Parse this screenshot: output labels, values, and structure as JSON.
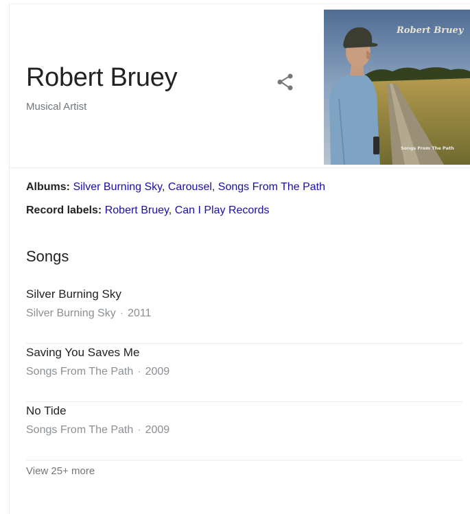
{
  "entity": {
    "name": "Robert Bruey",
    "type": "Musical Artist"
  },
  "cover": {
    "overlay_title": "Robert Bruey",
    "overlay_album": "Songs From The Path"
  },
  "facts": {
    "albums": {
      "label": "Albums:",
      "values": [
        "Silver Burning Sky",
        "Carousel",
        "Songs From The Path"
      ]
    },
    "record_labels": {
      "label": "Record labels:",
      "values": [
        "Robert Bruey",
        "Can I Play Records"
      ]
    }
  },
  "songs_section": {
    "title": "Songs",
    "items": [
      {
        "title": "Silver Burning Sky",
        "album": "Silver Burning Sky",
        "year": "2011"
      },
      {
        "title": "Saving You Saves Me",
        "album": "Songs From The Path",
        "year": "2009"
      },
      {
        "title": "No Tide",
        "album": "Songs From The Path",
        "year": "2009"
      }
    ],
    "view_more": "View 25+ more",
    "separator": "·"
  },
  "colors": {
    "link": "#1a0dab",
    "text": "#222222",
    "muted": "#70757a"
  },
  "icons": {
    "share": "share-icon"
  }
}
